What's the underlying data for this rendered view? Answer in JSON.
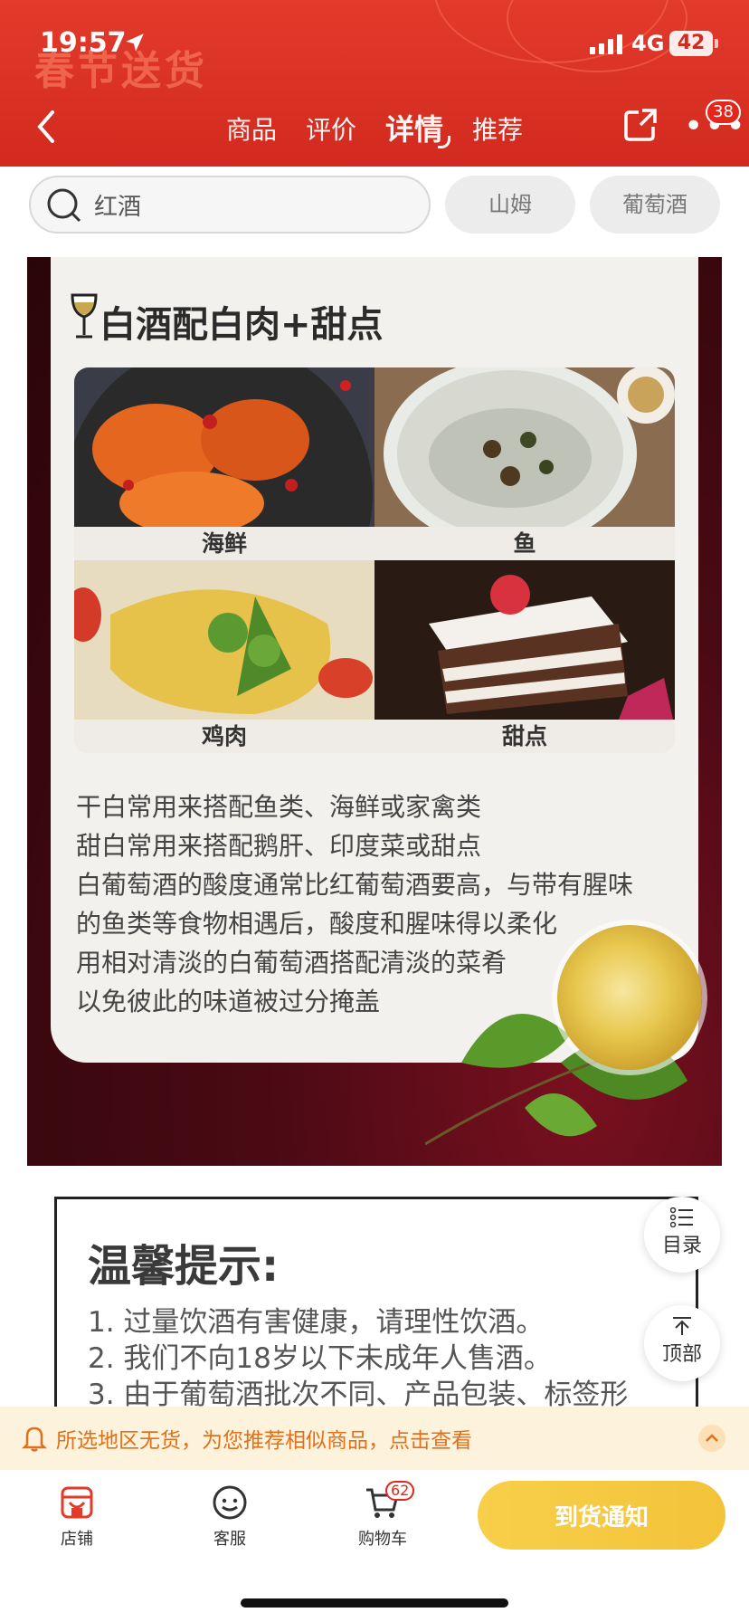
{
  "status_bar": {
    "time": "19:57",
    "network": "4G",
    "battery": "42"
  },
  "header": {
    "decor_text": "春节送货",
    "tabs": [
      {
        "label": "商品"
      },
      {
        "label": "评价"
      },
      {
        "label": "详情",
        "active": true
      },
      {
        "label": "推荐"
      }
    ],
    "more_badge": "38"
  },
  "search": {
    "value": "红酒",
    "suggestions": [
      "山姆",
      "葡萄酒"
    ]
  },
  "poster": {
    "title": "白酒配白肉+甜点",
    "foods": [
      {
        "label": "海鲜"
      },
      {
        "label": "鱼"
      },
      {
        "label": "鸡肉"
      },
      {
        "label": "甜点"
      }
    ],
    "text_lines": [
      "干白常用来搭配鱼类、海鲜或家禽类",
      "甜白常用来搭配鹅肝、印度菜或甜点",
      "白葡萄酒的酸度通常比红葡萄酒要高，与带有腥味",
      "的鱼类等食物相遇后，酸度和腥味得以柔化",
      "用相对清淡的白葡萄酒搭配清淡的菜肴",
      "以免彼此的味道被过分掩盖"
    ]
  },
  "tips": {
    "title": "温馨提示:",
    "items": [
      "1. 过量饮酒有害健康，请理性饮酒。",
      "2. 我们不向18岁以下未成年人售酒。",
      "3. 由于葡萄酒批次不同、产品包装、标签形"
    ]
  },
  "float_buttons": {
    "catalog": "目录",
    "top": "顶部"
  },
  "notice": {
    "text": "所选地区无货，为您推荐相似商品，点击查看"
  },
  "bottom_bar": {
    "store": "店铺",
    "service": "客服",
    "cart": "购物车",
    "cart_count": "62",
    "notify": "到货通知"
  },
  "colors": {
    "header_red": "#d22a1e",
    "notice_orange": "#e0711c",
    "button_yellow": "#f5c73f"
  }
}
